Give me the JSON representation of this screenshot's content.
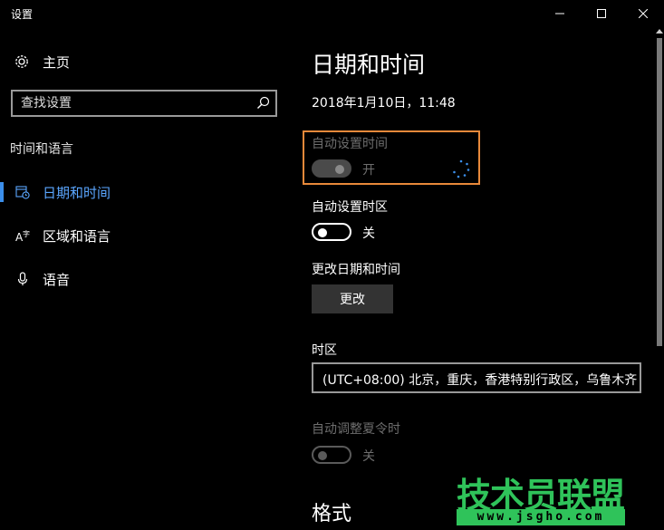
{
  "window": {
    "title": "设置"
  },
  "sidebar": {
    "home_label": "主页",
    "search_placeholder": "查找设置",
    "section_label": "时间和语言",
    "items": [
      {
        "label": "日期和时间",
        "icon": "calendar-clock-icon",
        "selected": true
      },
      {
        "label": "区域和语言",
        "icon": "language-icon",
        "selected": false
      },
      {
        "label": "语音",
        "icon": "microphone-icon",
        "selected": false
      }
    ]
  },
  "main": {
    "title": "日期和时间",
    "current_datetime": "2018年1月10日，11:48",
    "auto_time": {
      "label": "自动设置时间",
      "state": "开",
      "on": true,
      "disabled": true
    },
    "auto_timezone": {
      "label": "自动设置时区",
      "state": "关",
      "on": false
    },
    "change_datetime": {
      "label": "更改日期和时间",
      "button": "更改"
    },
    "timezone": {
      "label": "时区",
      "value": "(UTC+08:00) 北京，重庆，香港特别行政区，乌鲁木齐"
    },
    "dst": {
      "label": "自动调整夏令时",
      "state": "关",
      "on": false,
      "disabled": true
    },
    "format_heading": "格式"
  },
  "watermark": {
    "text": "技术员联盟",
    "url": "www.jsgho.com"
  },
  "colors": {
    "accent": "#3b8eea",
    "highlight": "#e8893a",
    "watermark": "#2fc35a"
  }
}
